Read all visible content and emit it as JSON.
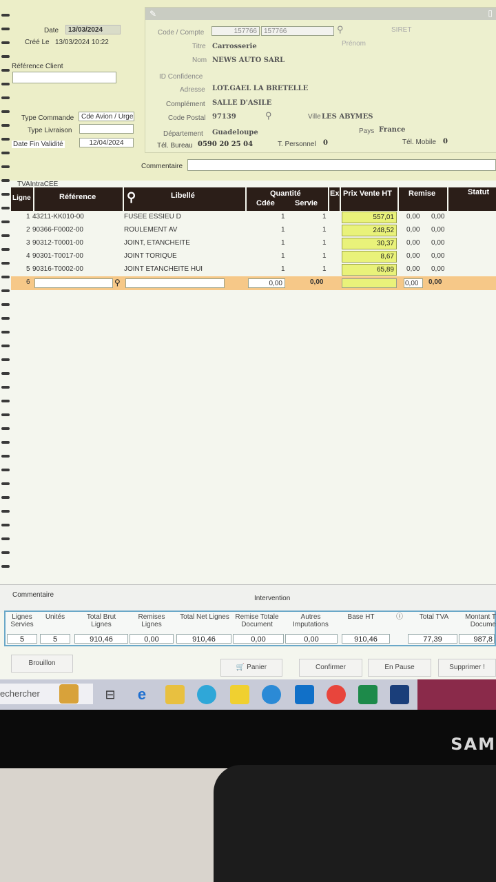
{
  "header": {
    "date_label": "Date",
    "date_value": "13/03/2024",
    "cree_le_label": "Créé Le",
    "cree_le_value": "13/03/2024 10:22",
    "reference_client_label": "Référence Client",
    "type_commande_label": "Type Commande",
    "type_commande_value": "Cde Avion / Urge",
    "type_livraison_label": "Type Livraison",
    "date_fin_validite_label": "Date Fin Validité",
    "date_fin_validite_value": "12/04/2024",
    "tva_label": "TVAIntraCEE",
    "commentaire_label": "Commentaire"
  },
  "client": {
    "code_compte_label": "Code / Compte",
    "code_compte_value1": "157766",
    "code_compte_value2": "157766",
    "siret_label": "SIRET",
    "titre_label": "Titre",
    "titre_value": "Carrosserie",
    "prenom_label": "Prénom",
    "nom_label": "Nom",
    "nom_value": "NEWS AUTO SARL",
    "id_confidence_label": "ID Confidence",
    "adresse_label": "Adresse",
    "adresse_value": "LOT.GAEL LA BRETELLE",
    "complement_label": "Complément",
    "complement_value": "SALLE D'ASILE",
    "code_postal_label": "Code Postal",
    "code_postal_value": "97139",
    "ville_label": "Ville",
    "ville_value": "LES ABYMES",
    "departement_label": "Département",
    "departement_value": "Guadeloupe",
    "pays_label": "Pays",
    "pays_value": "France",
    "tel_bureau_label": "Tél. Bureau",
    "tel_bureau_value": "0590 20 25 04",
    "tel_perso_label": "T. Personnel",
    "tel_perso_value": "0",
    "tel_mobile_label": "Tél. Mobile",
    "tel_mobile_value": "0"
  },
  "table": {
    "headers": {
      "ligne": "Ligne",
      "reference": "Référence",
      "libelle": "Libellé",
      "quantite": "Quantité",
      "cdee": "Cdée",
      "servie": "Servie",
      "ex": "Ex",
      "prix": "Prix Vente HT",
      "remise": "Remise",
      "statut": "Statut"
    },
    "rows": [
      {
        "ligne": "1",
        "reference": "43211-KK010-00",
        "libelle": "FUSEE ESSIEU D",
        "cdee": "1",
        "servie": "1",
        "prix": "557,01",
        "remise1": "0,00",
        "remise2": "0,00"
      },
      {
        "ligne": "2",
        "reference": "90366-F0002-00",
        "libelle": "ROULEMENT AV",
        "cdee": "1",
        "servie": "1",
        "prix": "248,52",
        "remise1": "0,00",
        "remise2": "0,00"
      },
      {
        "ligne": "3",
        "reference": "90312-T0001-00",
        "libelle": "JOINT, ETANCHEITE",
        "cdee": "1",
        "servie": "1",
        "prix": "30,37",
        "remise1": "0,00",
        "remise2": "0,00"
      },
      {
        "ligne": "4",
        "reference": "90301-T0017-00",
        "libelle": "JOINT TORIQUE",
        "cdee": "1",
        "servie": "1",
        "prix": "8,67",
        "remise1": "0,00",
        "remise2": "0,00"
      },
      {
        "ligne": "5",
        "reference": "90316-T0002-00",
        "libelle": "JOINT ETANCHEITE HUI",
        "cdee": "1",
        "servie": "1",
        "prix": "65,89",
        "remise1": "0,00",
        "remise2": "0,00"
      }
    ],
    "new_row": {
      "ligne": "6",
      "cdee": "0,00",
      "servie": "0,00",
      "remise1": "0,00",
      "remise2": "0,00"
    }
  },
  "footer": {
    "commentaire_label": "Commentaire",
    "intervention_label": "Intervention"
  },
  "totals": {
    "lignes_servies_label": "Lignes Servies",
    "lignes_servies_value": "5",
    "unites_label": "Unités",
    "unites_value": "5",
    "total_brut_label": "Total Brut Lignes",
    "total_brut_value": "910,46",
    "remises_lignes_label": "Remises Lignes",
    "remises_lignes_value": "0,00",
    "total_net_label": "Total Net Lignes",
    "total_net_value": "910,46",
    "remise_totale_label": "Remise Totale Document",
    "remise_totale_value": "0,00",
    "autres_imputations_label": "Autres Imputations",
    "autres_imputations_value": "0,00",
    "base_ht_label": "Base HT",
    "base_ht_value": "910,46",
    "total_tva_label": "Total TVA",
    "total_tva_value": "77,39",
    "montant_label": "Montant T Docume",
    "montant_value": "987,8"
  },
  "buttons": {
    "brouillon": "Brouillon",
    "panier": "Panier",
    "confirmer": "Confirmer",
    "en_pause": "En Pause",
    "supprimer": "Supprimer !"
  },
  "taskbar": {
    "search_text": "echercher"
  },
  "monitor": {
    "brand": "SAM"
  }
}
